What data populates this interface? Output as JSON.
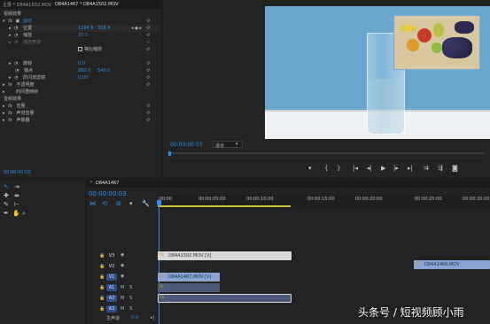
{
  "effect_controls": {
    "tabs": [
      "主要 * D84A1502.MOV",
      "D84A1467 * D84A1502.MOV"
    ],
    "section_video": "视频效果",
    "motion": "运动",
    "position_label": "位置",
    "position_x": "1184.6",
    "position_y": "318.4",
    "scale_label": "缩放",
    "scale_value": "37.1",
    "scale_width_label": "缩放宽度",
    "uniform_scale_label": "等比缩放",
    "rotation_label": "旋转",
    "rotation_value": "0.0",
    "anchor_label": "锚点",
    "anchor_x": "960.0",
    "anchor_y": "540.0",
    "flicker_label": "防闪烁滤镜",
    "flicker_value": "0.00",
    "opacity_label": "不透明度",
    "time_remap_label": "时间重映射",
    "section_audio": "音频效果",
    "volume_label": "音量",
    "channel_volume_label": "声道音量",
    "panner_label": "声像器",
    "timecode": "00:00:00:03"
  },
  "monitor": {
    "timecode": "00:00:00:03",
    "zoom": "适合",
    "controls": [
      "marker-icon",
      "in-point-icon",
      "out-point-icon",
      "go-to-in-icon",
      "step-back-icon",
      "play-icon",
      "step-forward-icon",
      "go-to-out-icon",
      "insert-icon",
      "overwrite-icon",
      "export-frame-icon"
    ]
  },
  "timeline": {
    "sequence_tab": "D84A1467",
    "timecode": "00:00:00:03",
    "ruler": [
      ":00:00",
      "00:00:05:00",
      "00:00:10:00",
      "00:00:15:00",
      "00:00:20:00",
      "00:00:25:00",
      "00:00:30:00"
    ],
    "tracks": [
      {
        "id": "v3",
        "label": "V3"
      },
      {
        "id": "v2",
        "label": "V2"
      },
      {
        "id": "v1",
        "label": "V1"
      },
      {
        "id": "a1",
        "label": "A1"
      },
      {
        "id": "a2",
        "label": "A2"
      },
      {
        "id": "a3",
        "label": "A3"
      }
    ],
    "master_label": "主声道",
    "master_value": "0.0",
    "clips": {
      "v3": "D84A1502.MOV [V]",
      "v2": "D84A1468.MOV",
      "v1": "D84A1467.MOV [V]"
    }
  },
  "colors": {
    "accent_blue": "#2d8ceb",
    "video_clip": "#8aa5d2",
    "v3_clip": "#d8d8d8",
    "audio_clip": "#4a5a78",
    "selected_track": "#2f4f8a"
  },
  "watermark": "头条号 / 短视频顾小雨"
}
